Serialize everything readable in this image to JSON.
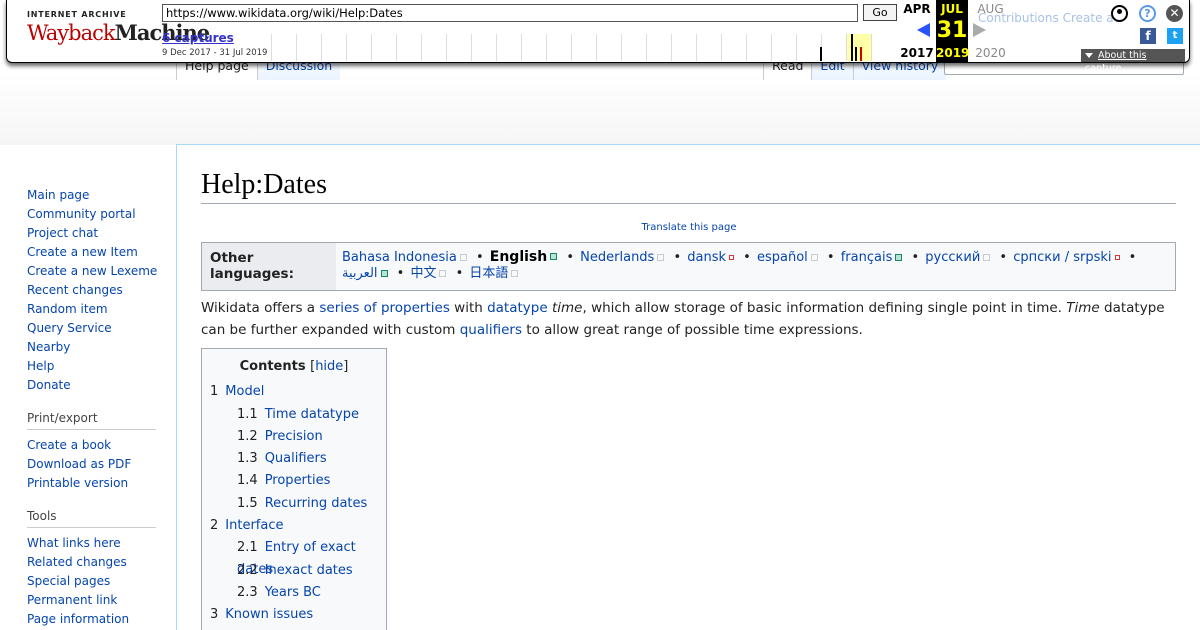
{
  "wayback": {
    "logo_top": "INTERNET ARCHIVE",
    "logo_main_a": "Wayback",
    "logo_main_b": "Machine",
    "url": "https://www.wikidata.org/wiki/Help:Dates",
    "go_label": "Go",
    "captures_label": "6 captures",
    "captures_range": "9 Dec 2017 - 31 Jul 2019",
    "prev_month": "APR",
    "cur_month": "JUL",
    "next_month": "AUG",
    "cur_day": "31",
    "prev_year": "2017",
    "cur_year": "2019",
    "next_year": "2020",
    "about_label": "About this capture",
    "ghost_text": "Contributions   Create ac",
    "icons": [
      "user-icon",
      "help-icon",
      "close-icon",
      "facebook-icon",
      "twitter-icon"
    ]
  },
  "tabs": {
    "left": [
      {
        "label": "Help page",
        "selected": true
      },
      {
        "label": "Discussion",
        "selected": false
      }
    ],
    "right": [
      {
        "label": "Read",
        "selected": true
      },
      {
        "label": "Edit",
        "selected": false
      },
      {
        "label": "View history",
        "selected": false
      }
    ]
  },
  "sidebar": {
    "navigation": [
      "Main page",
      "Community portal",
      "Project chat",
      "Create a new Item",
      "Create a new Lexeme",
      "Recent changes",
      "Random item",
      "Query Service",
      "Nearby",
      "Help",
      "Donate"
    ],
    "print_heading": "Print/export",
    "print": [
      "Create a book",
      "Download as PDF",
      "Printable version"
    ],
    "tools_heading": "Tools",
    "tools": [
      "What links here",
      "Related changes",
      "Special pages",
      "Permanent link",
      "Page information"
    ]
  },
  "page": {
    "title": "Help:Dates",
    "translate": "Translate this page",
    "lang_label": "Other languages:",
    "languages": [
      {
        "name": "Bahasa Indonesia",
        "mark": "grey"
      },
      {
        "name": "English",
        "mark": "green",
        "current": true
      },
      {
        "name": "Nederlands",
        "mark": "grey"
      },
      {
        "name": "dansk",
        "mark": "red"
      },
      {
        "name": "español",
        "mark": "grey"
      },
      {
        "name": "français",
        "mark": "green"
      },
      {
        "name": "русский",
        "mark": "grey"
      },
      {
        "name": "српски / srpski",
        "mark": "red"
      },
      {
        "name": "العربية",
        "mark": "green"
      },
      {
        "name": "中文",
        "mark": "grey"
      },
      {
        "name": "日本語",
        "mark": "grey"
      }
    ],
    "intro": {
      "p1": "Wikidata offers a ",
      "l1": "series of properties",
      "p2": " with ",
      "l2": "datatype",
      "p3": " ",
      "i1": "time",
      "p4": ", which allow storage of basic information defining single point in time. ",
      "i2": "Time",
      "p5": " datatype can be further expanded with custom ",
      "l3": "qualifiers",
      "p6": " to allow great range of possible time expressions."
    },
    "toc_title": "Contents",
    "toc_hide": "hide",
    "toc": [
      {
        "num": "1",
        "text": "Model",
        "level": 1
      },
      {
        "num": "1.1",
        "text": "Time datatype",
        "level": 2
      },
      {
        "num": "1.2",
        "text": "Precision",
        "level": 2
      },
      {
        "num": "1.3",
        "text": "Qualifiers",
        "level": 2
      },
      {
        "num": "1.4",
        "text": "Properties",
        "level": 2
      },
      {
        "num": "1.5",
        "text": "Recurring dates",
        "level": 2
      },
      {
        "num": "2",
        "text": "Interface",
        "level": 1
      },
      {
        "num": "2.1",
        "text": "Entry of exact dates",
        "level": 2
      },
      {
        "num": "2.2",
        "text": "Inexact dates",
        "level": 2
      },
      {
        "num": "2.3",
        "text": "Years BC",
        "level": 2
      },
      {
        "num": "3",
        "text": "Known issues",
        "level": 1
      }
    ]
  }
}
